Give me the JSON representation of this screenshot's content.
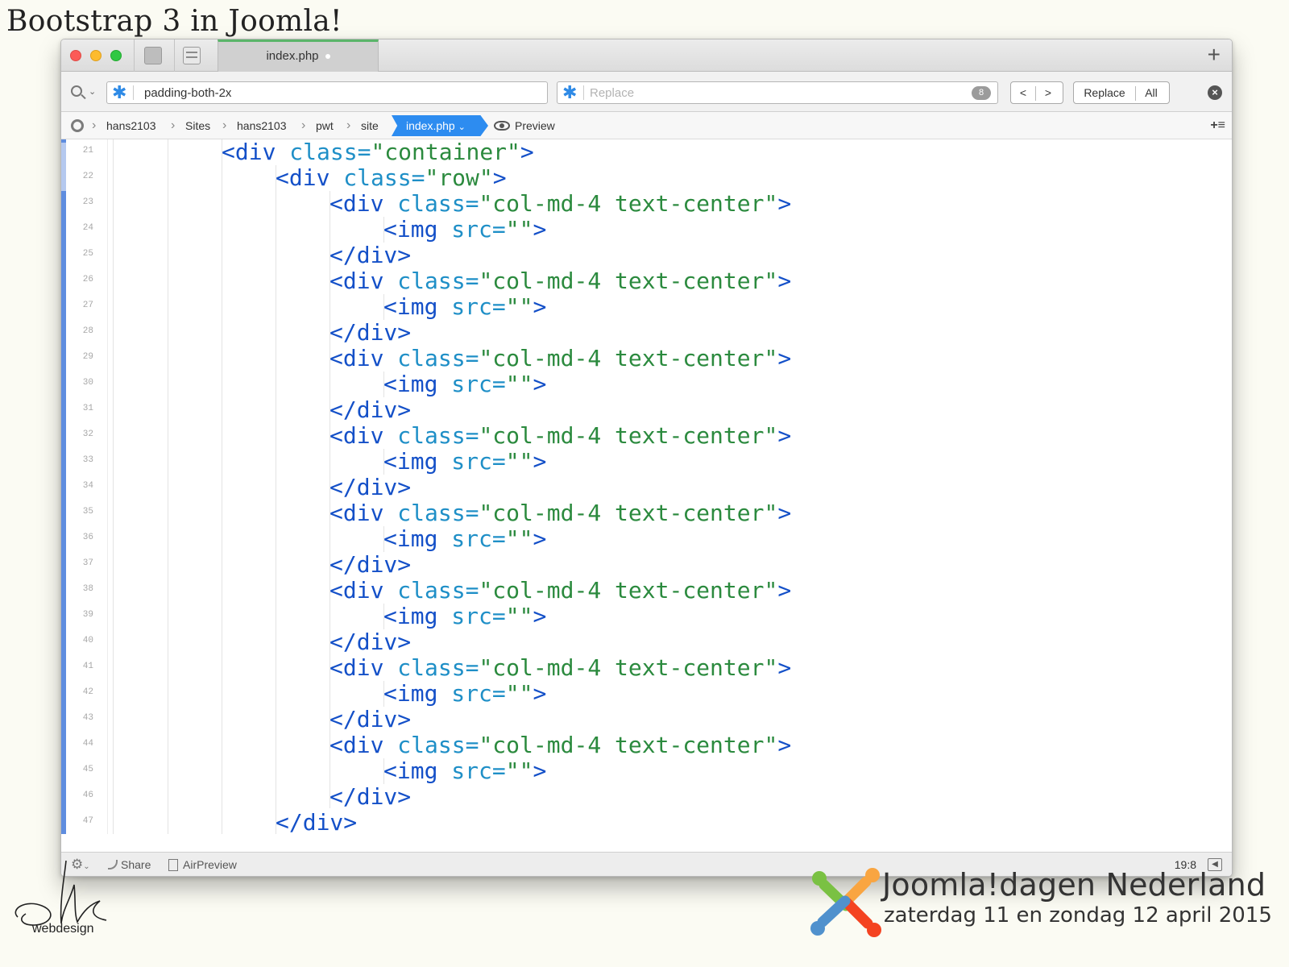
{
  "slide": {
    "title": "Bootstrap 3 in Joomla!"
  },
  "window": {
    "tab_title": "index.php",
    "new_tab_label": "+"
  },
  "search": {
    "find_value": "padding-both-2x",
    "replace_placeholder": "Replace",
    "match_count": "8",
    "prev_label": "<",
    "next_label": ">",
    "replace_label": "Replace",
    "all_label": "All"
  },
  "breadcrumb": {
    "items": [
      "hans2103",
      "Sites",
      "hans2103",
      "pwt",
      "site"
    ],
    "active": "index.php",
    "preview": "Preview"
  },
  "editor": {
    "lines": [
      {
        "num": "21",
        "indent": 2,
        "parts": [
          {
            "t": "tag",
            "v": "<div "
          },
          {
            "t": "attr",
            "v": "class="
          },
          {
            "t": "str",
            "v": "\"container\""
          },
          {
            "t": "tag",
            "v": ">"
          }
        ]
      },
      {
        "num": "22",
        "indent": 3,
        "parts": [
          {
            "t": "tag",
            "v": "<div "
          },
          {
            "t": "attr",
            "v": "class="
          },
          {
            "t": "str",
            "v": "\"row\""
          },
          {
            "t": "tag",
            "v": ">"
          }
        ]
      },
      {
        "num": "23",
        "indent": 4,
        "parts": [
          {
            "t": "tag",
            "v": "<div "
          },
          {
            "t": "attr",
            "v": "class="
          },
          {
            "t": "str",
            "v": "\"col-md-4 text-center\""
          },
          {
            "t": "tag",
            "v": ">"
          }
        ]
      },
      {
        "num": "24",
        "indent": 5,
        "parts": [
          {
            "t": "tag",
            "v": "<img "
          },
          {
            "t": "attr",
            "v": "src="
          },
          {
            "t": "str",
            "v": "\"\""
          },
          {
            "t": "tag",
            "v": ">"
          }
        ]
      },
      {
        "num": "25",
        "indent": 4,
        "parts": [
          {
            "t": "tag",
            "v": "</div>"
          }
        ]
      },
      {
        "num": "26",
        "indent": 4,
        "parts": [
          {
            "t": "tag",
            "v": "<div "
          },
          {
            "t": "attr",
            "v": "class="
          },
          {
            "t": "str",
            "v": "\"col-md-4 text-center\""
          },
          {
            "t": "tag",
            "v": ">"
          }
        ]
      },
      {
        "num": "27",
        "indent": 5,
        "parts": [
          {
            "t": "tag",
            "v": "<img "
          },
          {
            "t": "attr",
            "v": "src="
          },
          {
            "t": "str",
            "v": "\"\""
          },
          {
            "t": "tag",
            "v": ">"
          }
        ]
      },
      {
        "num": "28",
        "indent": 4,
        "parts": [
          {
            "t": "tag",
            "v": "</div>"
          }
        ]
      },
      {
        "num": "29",
        "indent": 4,
        "parts": [
          {
            "t": "tag",
            "v": "<div "
          },
          {
            "t": "attr",
            "v": "class="
          },
          {
            "t": "str",
            "v": "\"col-md-4 text-center\""
          },
          {
            "t": "tag",
            "v": ">"
          }
        ]
      },
      {
        "num": "30",
        "indent": 5,
        "parts": [
          {
            "t": "tag",
            "v": "<img "
          },
          {
            "t": "attr",
            "v": "src="
          },
          {
            "t": "str",
            "v": "\"\""
          },
          {
            "t": "tag",
            "v": ">"
          }
        ]
      },
      {
        "num": "31",
        "indent": 4,
        "parts": [
          {
            "t": "tag",
            "v": "</div>"
          }
        ]
      },
      {
        "num": "32",
        "indent": 4,
        "parts": [
          {
            "t": "tag",
            "v": "<div "
          },
          {
            "t": "attr",
            "v": "class="
          },
          {
            "t": "str",
            "v": "\"col-md-4 text-center\""
          },
          {
            "t": "tag",
            "v": ">"
          }
        ]
      },
      {
        "num": "33",
        "indent": 5,
        "parts": [
          {
            "t": "tag",
            "v": "<img "
          },
          {
            "t": "attr",
            "v": "src="
          },
          {
            "t": "str",
            "v": "\"\""
          },
          {
            "t": "tag",
            "v": ">"
          }
        ]
      },
      {
        "num": "34",
        "indent": 4,
        "parts": [
          {
            "t": "tag",
            "v": "</div>"
          }
        ]
      },
      {
        "num": "35",
        "indent": 4,
        "parts": [
          {
            "t": "tag",
            "v": "<div "
          },
          {
            "t": "attr",
            "v": "class="
          },
          {
            "t": "str",
            "v": "\"col-md-4 text-center\""
          },
          {
            "t": "tag",
            "v": ">"
          }
        ]
      },
      {
        "num": "36",
        "indent": 5,
        "parts": [
          {
            "t": "tag",
            "v": "<img "
          },
          {
            "t": "attr",
            "v": "src="
          },
          {
            "t": "str",
            "v": "\"\""
          },
          {
            "t": "tag",
            "v": ">"
          }
        ]
      },
      {
        "num": "37",
        "indent": 4,
        "parts": [
          {
            "t": "tag",
            "v": "</div>"
          }
        ]
      },
      {
        "num": "38",
        "indent": 4,
        "parts": [
          {
            "t": "tag",
            "v": "<div "
          },
          {
            "t": "attr",
            "v": "class="
          },
          {
            "t": "str",
            "v": "\"col-md-4 text-center\""
          },
          {
            "t": "tag",
            "v": ">"
          }
        ]
      },
      {
        "num": "39",
        "indent": 5,
        "parts": [
          {
            "t": "tag",
            "v": "<img "
          },
          {
            "t": "attr",
            "v": "src="
          },
          {
            "t": "str",
            "v": "\"\""
          },
          {
            "t": "tag",
            "v": ">"
          }
        ]
      },
      {
        "num": "40",
        "indent": 4,
        "parts": [
          {
            "t": "tag",
            "v": "</div>"
          }
        ]
      },
      {
        "num": "41",
        "indent": 4,
        "parts": [
          {
            "t": "tag",
            "v": "<div "
          },
          {
            "t": "attr",
            "v": "class="
          },
          {
            "t": "str",
            "v": "\"col-md-4 text-center\""
          },
          {
            "t": "tag",
            "v": ">"
          }
        ]
      },
      {
        "num": "42",
        "indent": 5,
        "parts": [
          {
            "t": "tag",
            "v": "<img "
          },
          {
            "t": "attr",
            "v": "src="
          },
          {
            "t": "str",
            "v": "\"\""
          },
          {
            "t": "tag",
            "v": ">"
          }
        ]
      },
      {
        "num": "43",
        "indent": 4,
        "parts": [
          {
            "t": "tag",
            "v": "</div>"
          }
        ]
      },
      {
        "num": "44",
        "indent": 4,
        "parts": [
          {
            "t": "tag",
            "v": "<div "
          },
          {
            "t": "attr",
            "v": "class="
          },
          {
            "t": "str",
            "v": "\"col-md-4 text-center\""
          },
          {
            "t": "tag",
            "v": ">"
          }
        ]
      },
      {
        "num": "45",
        "indent": 5,
        "parts": [
          {
            "t": "tag",
            "v": "<img "
          },
          {
            "t": "attr",
            "v": "src="
          },
          {
            "t": "str",
            "v": "\"\""
          },
          {
            "t": "tag",
            "v": ">"
          }
        ]
      },
      {
        "num": "46",
        "indent": 4,
        "parts": [
          {
            "t": "tag",
            "v": "</div>"
          }
        ]
      },
      {
        "num": "47",
        "indent": 3,
        "parts": [
          {
            "t": "tag",
            "v": "</div>"
          }
        ]
      }
    ]
  },
  "status": {
    "share_label": "Share",
    "airpreview_label": "AirPreview",
    "cursor_position": "19:8"
  },
  "branding": {
    "left_logo_sub": "webdesign",
    "event_title": "Joomla!dagen Nederland",
    "event_date": "zaterdag 11 en zondag 12 april 2015"
  },
  "colors": {
    "tag": "#1450c8",
    "attr": "#1f8fc7",
    "string": "#2b8a3e",
    "active_crumb": "#2d8cf0"
  }
}
